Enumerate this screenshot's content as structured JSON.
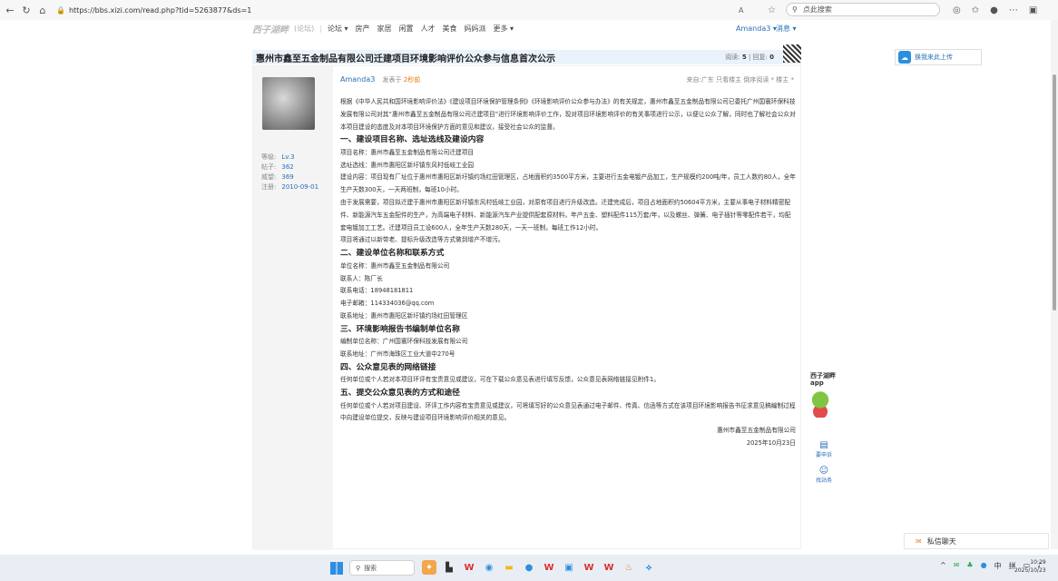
{
  "browser": {
    "url": "https://bbs.xizi.com/read.php?tid=5263877&ds=1",
    "read_aloud": "A",
    "search_placeholder": "点此搜索"
  },
  "topnav": {
    "logo": "西子湖畔",
    "logo_sub": "(论坛)",
    "items": [
      "论坛 ▾",
      "房产",
      "家居",
      "闲置",
      "人才",
      "美食",
      "妈妈派",
      "更多 ▾"
    ],
    "user": "Amanda3 ▾",
    "messages": "消息 ▾"
  },
  "post": {
    "title": "惠州市鑫至五金制品有限公司迁建项目环境影响评价公众参与信息首次公示",
    "views_label": "阅读:",
    "views": "5",
    "replies_label": "回复:",
    "replies": "0",
    "author": "Amanda3",
    "posted_prefix": "发表于",
    "posted_time": "2秒前",
    "header_right": "来自:广东  只看楼主  倒序阅读  * 楼主 *",
    "meta": [
      {
        "label": "等级:",
        "value": "Lv.3"
      },
      {
        "label": "帖子:",
        "value": "362"
      },
      {
        "label": "威望:",
        "value": "369"
      },
      {
        "label": "注册:",
        "value": "2010-09-01"
      }
    ],
    "paragraphs": [
      {
        "type": "p",
        "text": "根据《中华人民共和国环境影响评价法》《建设项目环境保护管理条例》《环境影响评价公众参与办法》的有关规定，惠州市鑫至五金制品有限公司已委托广州国寰环保科技发展有限公司对其“惠州市鑫至五金制品有限公司迁建项目”进行环境影响评价工作，现对项目环境影响评价的有关事项进行公示，以便让公众了解，同时也了解社会公众对本项目建设的态度及对本项目环境保护方面的意见和建议，接受社会公众的监督。"
      },
      {
        "type": "h",
        "text": "一、建设项目名称、选址选线及建设内容"
      },
      {
        "type": "p",
        "text": "项目名称：惠州市鑫至五金制品有限公司迁建项目"
      },
      {
        "type": "p",
        "text": "选址选线：惠州市惠阳区新圩镇东风村低岐工业园"
      },
      {
        "type": "p",
        "text": "建设内容：项目现有厂址位于惠州市惠阳区新圩镇约场红田管理区，占地面积约3500平方米，主要进行五金电镀产品加工，生产规模约200吨/年，员工人数约80人，全年生产天数300天，一天两班制，每班10小时。"
      },
      {
        "type": "p",
        "text": "由于发展需要，项目拟迁建于惠州市惠阳区新圩镇东风村低岐工业园，对原有项目进行升级改造。迁建完成后，项目占地面积约50604平方米，主要从事电子材料精密配件、新能源汽车五金配件的生产，为高端电子材料、新能源汽车产业提供配套原材料，年产五金、塑料配件115万套/年，以及螺丝、弹簧、电子插针等零配件若干，均配套电镀加工工艺。迁建项目员工设600人，全年生产天数280天，一天一班制，每班工作12小时。"
      },
      {
        "type": "p",
        "text": "项目将通过以新带老、提标升级改造等方式做到增产不增污。"
      },
      {
        "type": "h",
        "text": "二、建设单位名称和联系方式"
      },
      {
        "type": "p",
        "text": "单位名称：惠州市鑫至五金制品有限公司"
      },
      {
        "type": "p",
        "text": "联系人：陈厂长"
      },
      {
        "type": "p",
        "text": "联系电话：18948181811"
      },
      {
        "type": "p",
        "text": "电子邮箱：114334036@qq.com"
      },
      {
        "type": "p",
        "text": "联系地址：惠州市惠阳区新圩镇约场红田管理区"
      },
      {
        "type": "h",
        "text": "三、环境影响报告书编制单位名称"
      },
      {
        "type": "p",
        "text": "编制单位名称：广州国寰环保科技发展有限公司"
      },
      {
        "type": "p",
        "text": "联系地址：广州市海珠区工业大道中270号"
      },
      {
        "type": "h",
        "text": "四、公众意见表的网络链接"
      },
      {
        "type": "p",
        "text": "任何单位或个人若对本项目环评有宝贵意见或建议，可在下载公众意见表进行填写反馈，公众意见表网络链接见附件1。"
      },
      {
        "type": "h",
        "text": "五、提交公众意见表的方式和途径"
      },
      {
        "type": "p",
        "text": "任何单位或个人若对项目建设、环评工作内容有宝贵意见或建议，可将填写好的公众意见表通过电子邮件、传真、信函等方式在该项目环境影响报告书征求意见稿编制过程中向建设单位提交，反映与建设项目环境影响评价相关的意见。"
      },
      {
        "type": "r",
        "text": "惠州市鑫至五金制品有限公司"
      },
      {
        "type": "r",
        "text": "2025年10月23日"
      }
    ]
  },
  "right_panel": {
    "upload_label": "换我来此上传",
    "app_label_line1": "西子湖畔",
    "app_label_line2": "app",
    "tools": [
      "要申诉",
      "找站务"
    ],
    "chat_label": "私信聊天"
  },
  "taskbar": {
    "search_label": "搜索",
    "tray_lang": "中",
    "tray_layout": "拼",
    "time": "10:29",
    "date": "2025/10/23"
  }
}
